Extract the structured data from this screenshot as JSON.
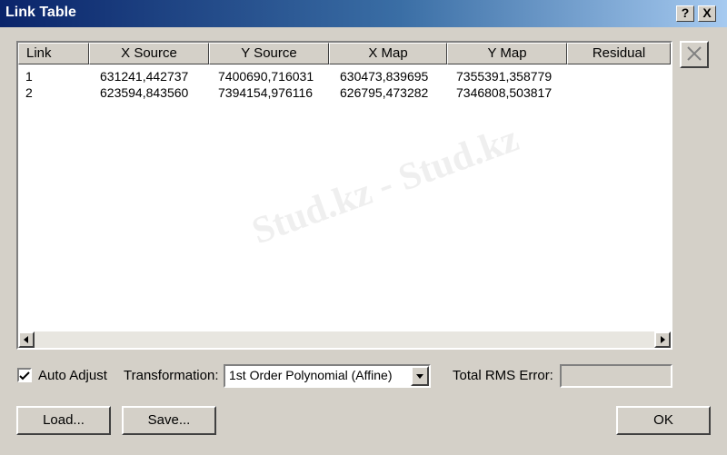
{
  "window": {
    "title": "Link Table",
    "help_button": "?",
    "close_button": "X"
  },
  "table": {
    "columns": [
      "Link",
      "X Source",
      "Y Source",
      "X Map",
      "Y Map",
      "Residual"
    ],
    "rows": [
      [
        "1",
        "631241,442737",
        "7400690,716031",
        "630473,839695",
        "7355391,358779",
        ""
      ],
      [
        "2",
        "623594,843560",
        "7394154,976116",
        "626795,473282",
        "7346808,503817",
        ""
      ]
    ]
  },
  "options": {
    "auto_adjust_label": "Auto Adjust",
    "auto_adjust_checked": true,
    "transformation_label": "Transformation:",
    "transformation_value": "1st Order Polynomial (Affine)",
    "rms_label": "Total RMS Error:",
    "rms_value": ""
  },
  "buttons": {
    "load": "Load...",
    "save": "Save...",
    "ok": "OK"
  },
  "watermark": {
    "text": "Stud.kz - Stud.kz"
  },
  "icons": {
    "delete_link": "close-x-icon",
    "scroll_left": "arrow-left-icon",
    "scroll_right": "arrow-right-icon",
    "dropdown": "chevron-down-icon",
    "checkbox": "checkmark-icon"
  }
}
